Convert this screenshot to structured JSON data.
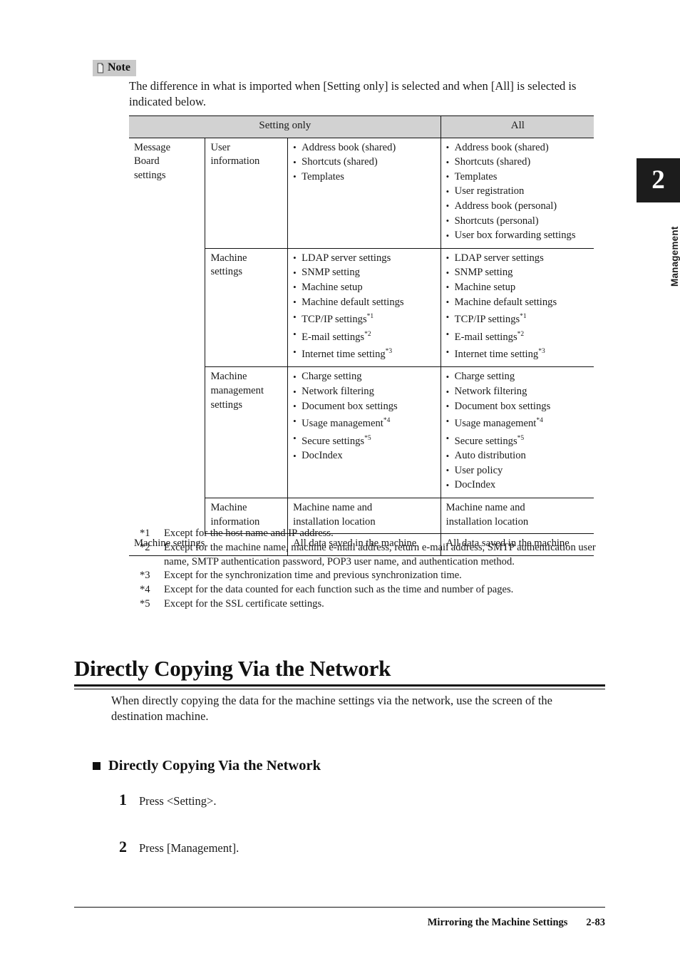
{
  "side_tab": {
    "chapter_number": "2",
    "chapter_label": "Management"
  },
  "note": {
    "label": "Note",
    "icon": "note-pencil-icon",
    "body": "The difference in what is imported when [Setting only] is selected and when [All] is selected is indicated below."
  },
  "table": {
    "headers": {
      "setting_only": "Setting only",
      "all": "All"
    },
    "rows": [
      {
        "category": "Message\nBoard\nsettings",
        "subcategory": "User\ninformation",
        "setting_only": [
          "Address book (shared)",
          "Shortcuts (shared)",
          "Templates"
        ],
        "all": [
          "Address book (shared)",
          "Shortcuts (shared)",
          "Templates",
          "User registration",
          "Address book (personal)",
          "Shortcuts (personal)",
          "User box forwarding settings"
        ]
      },
      {
        "subcategory": "Machine\nsettings",
        "setting_only": [
          "LDAP server settings",
          "SNMP setting",
          "Machine setup",
          "Machine default settings",
          "TCP/IP settings*1",
          "E-mail settings*2",
          "Internet time setting*3"
        ],
        "all": [
          "LDAP server settings",
          "SNMP setting",
          "Machine setup",
          "Machine default settings",
          "TCP/IP settings*1",
          "E-mail settings*2",
          "Internet time setting*3"
        ]
      },
      {
        "subcategory": "Machine\nmanagement\nsettings",
        "setting_only": [
          "Charge setting",
          "Network filtering",
          "Document box settings",
          "Usage management*4",
          "Secure settings*5",
          "DocIndex"
        ],
        "all": [
          "Charge setting",
          "Network filtering",
          "Document box settings",
          "Usage management*4",
          "Secure settings*5",
          "Auto distribution",
          "User policy",
          "DocIndex"
        ]
      },
      {
        "subcategory": "Machine\ninformation",
        "setting_only_plain": "Machine name and\ninstallation location",
        "all_plain": "Machine name and\ninstallation location"
      }
    ],
    "last_row": {
      "label": "Machine settings",
      "setting_only": "All data saved in the machine",
      "all": "All data saved in the machine"
    }
  },
  "footnotes": [
    {
      "mark": "*1",
      "text": "Except for the host name and IP address."
    },
    {
      "mark": "*2",
      "text": "Except for the machine name, machine e-mail address, return e-mail address, SMTP authentication user name, SMTP authentication password, POP3 user name, and authentication method."
    },
    {
      "mark": "*3",
      "text": "Except for the synchronization time and previous synchronization time."
    },
    {
      "mark": "*4",
      "text": "Except for the data counted for each function such as the time and number of pages."
    },
    {
      "mark": "*5",
      "text": "Except for the SSL certificate settings."
    }
  ],
  "section": {
    "h1": "Directly Copying Via the Network",
    "intro": "When directly copying the data for the machine settings via the network, use the screen of the destination machine.",
    "h2": "Directly Copying Via the Network"
  },
  "steps": [
    {
      "number": "1",
      "text": "Press <Setting>."
    },
    {
      "number": "2",
      "text": "Press [Management]."
    }
  ],
  "footer": {
    "section_title": "Mirroring the Machine Settings",
    "page_number": "2-83"
  },
  "colors": {
    "note_tag_bg": "#c9c9c9",
    "table_header_bg": "#d2d2d2",
    "side_tab_bg": "#1c1c1c",
    "text": "#1a1a1a"
  }
}
